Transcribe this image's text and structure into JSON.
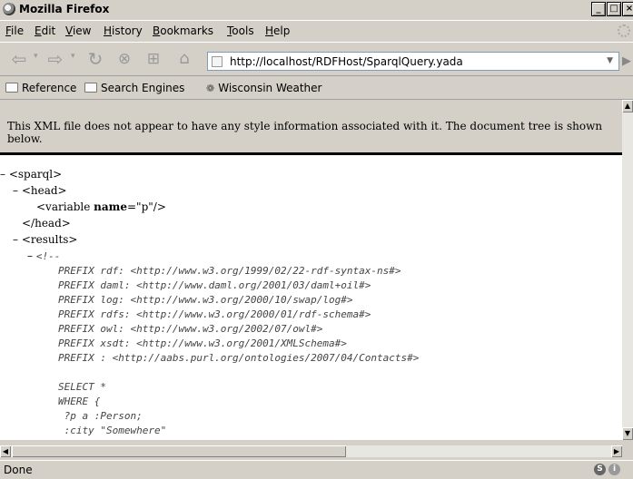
{
  "window": {
    "title": "Mozilla Firefox"
  },
  "menu": {
    "file": "File",
    "edit": "Edit",
    "view": "View",
    "history": "History",
    "bookmarks": "Bookmarks",
    "tools": "Tools",
    "help": "Help"
  },
  "navigation": {
    "url": "http://localhost/RDFHost/SparqlQuery.yada"
  },
  "bookmarks_bar": {
    "items": [
      "Reference",
      "Search Engines",
      "Wisconsin Weather"
    ]
  },
  "content": {
    "notice": "This XML file does not appear to have any style information associated with it. The document tree is shown below.",
    "tree": {
      "sparql_open": "<sparql>",
      "head_open": "<head>",
      "variable_tag": "<variable ",
      "variable_attr": "name",
      "variable_eq": "=\"",
      "variable_value": "p",
      "variable_close": "\"/>",
      "head_close": "</head>",
      "results_open": "<results>",
      "comment_open": "<!--",
      "comment_lines": [
        "PREFIX rdf: <http://www.w3.org/1999/02/22-rdf-syntax-ns#>",
        "PREFIX daml: <http://www.daml.org/2001/03/daml+oil#>",
        "PREFIX log: <http://www.w3.org/2000/10/swap/log#>",
        "PREFIX rdfs: <http://www.w3.org/2000/01/rdf-schema#>",
        "PREFIX owl: <http://www.w3.org/2002/07/owl#>",
        "PREFIX xsdt: <http://www.w3.org/2001/XMLSchema#>",
        "PREFIX : <http://aabs.purl.org/ontologies/2007/04/Contacts#>",
        "",
        "SELECT *",
        "WHERE {",
        " ?p a :Person;",
        " :city \"Somewhere\"",
        " }"
      ]
    }
  },
  "status": {
    "text": "Done"
  }
}
